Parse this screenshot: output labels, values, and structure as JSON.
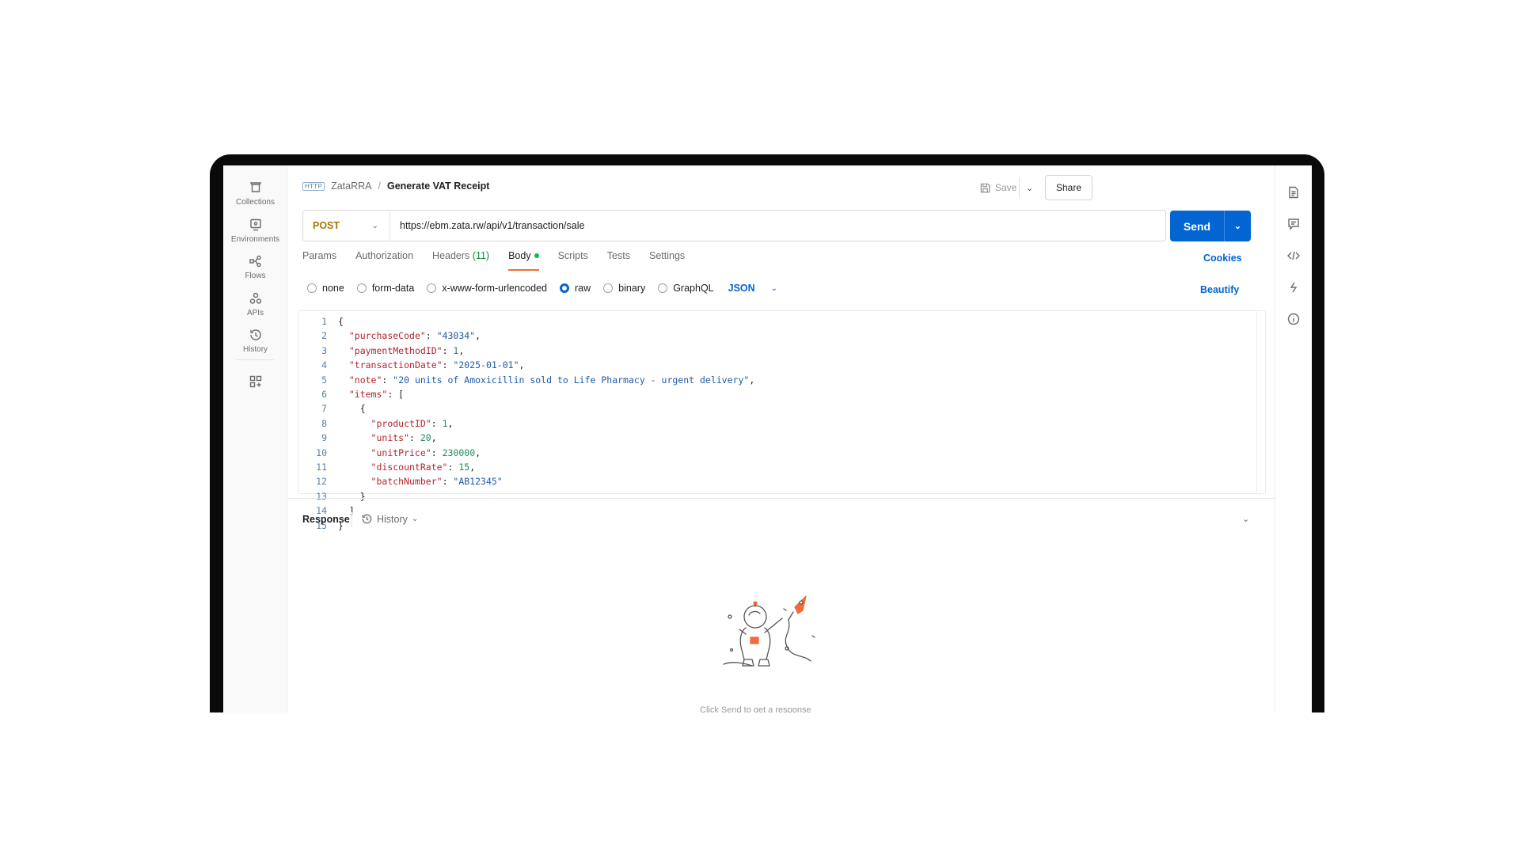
{
  "sidebar": {
    "items": [
      {
        "label": "Collections",
        "icon": "trash-can-icon"
      },
      {
        "label": "Environments",
        "icon": "environment-icon"
      },
      {
        "label": "Flows",
        "icon": "flows-icon"
      },
      {
        "label": "APIs",
        "icon": "apis-icon"
      },
      {
        "label": "History",
        "icon": "history-icon"
      }
    ]
  },
  "header": {
    "protocol_badge": "HTTP",
    "collection": "ZataRRA",
    "separator": "/",
    "title": "Generate VAT Receipt",
    "save_label": "Save",
    "share_label": "Share"
  },
  "request": {
    "method": "POST",
    "url": "https://ebm.zata.rw/api/v1/transaction/sale",
    "send_label": "Send"
  },
  "tabs": {
    "params": "Params",
    "authorization": "Authorization",
    "headers": "Headers",
    "headers_count": "(11)",
    "body": "Body",
    "scripts": "Scripts",
    "tests": "Tests",
    "settings": "Settings",
    "cookies": "Cookies"
  },
  "body_types": {
    "none": "none",
    "form_data": "form-data",
    "urlencoded": "x-www-form-urlencoded",
    "raw": "raw",
    "binary": "binary",
    "graphql": "GraphQL",
    "format": "JSON",
    "selected": "raw",
    "beautify": "Beautify"
  },
  "editor": {
    "line_numbers": [
      "1",
      "2",
      "3",
      "4",
      "5",
      "6",
      "7",
      "8",
      "9",
      "10",
      "11",
      "12",
      "13",
      "14",
      "15"
    ],
    "fields": {
      "purchaseCode": "\"43034\"",
      "paymentMethodID": "1",
      "transactionDate": "\"2025-01-01\"",
      "note": "\"20 units of Amoxicillin sold to Life Pharmacy - urgent delivery\"",
      "productID": "1",
      "units": "20",
      "unitPrice": "230000",
      "discountRate": "15",
      "batchNumber": "\"AB12345\""
    }
  },
  "response": {
    "title": "Response",
    "history_label": "History",
    "hint": "Click Send to get a response"
  },
  "colors": {
    "accent": "#0265d2",
    "tab_underline": "#f26b3a",
    "method_post": "#a8760a",
    "json_key": "#b0242b",
    "json_string": "#1d5aa8",
    "json_number": "#1f8a5a"
  }
}
